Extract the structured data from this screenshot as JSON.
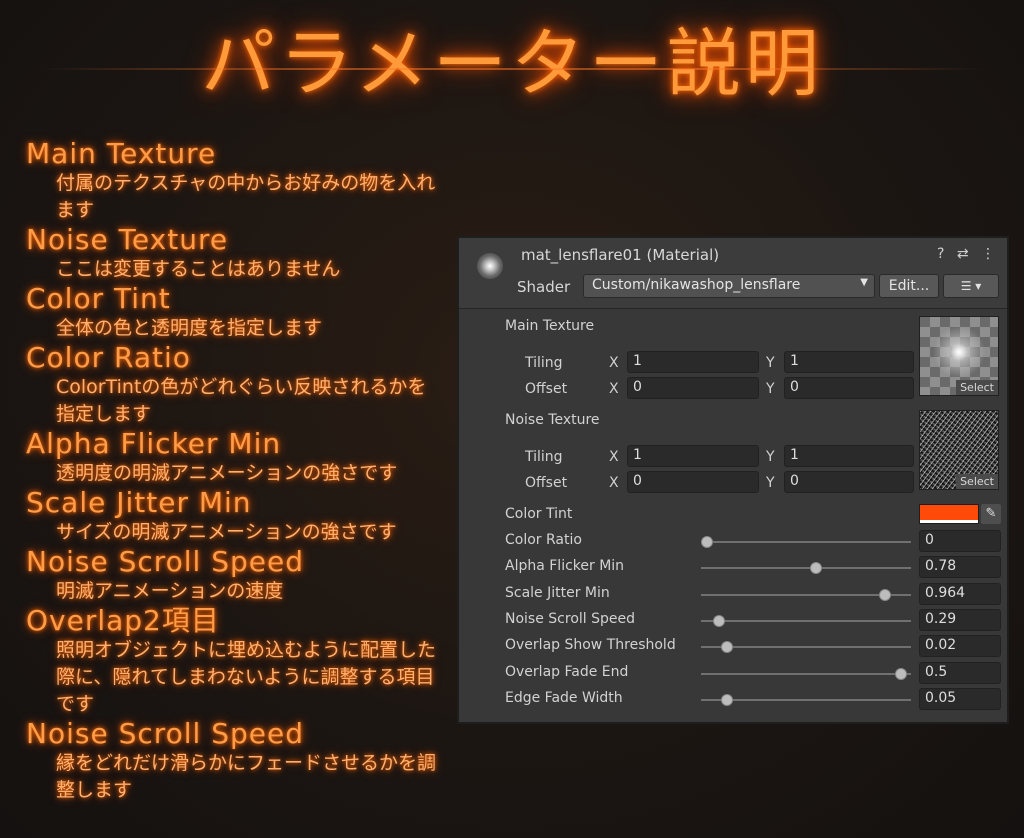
{
  "title": "パラメーター説明",
  "params": [
    {
      "name": "Main Texture",
      "desc": "付属のテクスチャの中からお好みの物を入れます"
    },
    {
      "name": "Noise Texture",
      "desc": "ここは変更することはありません"
    },
    {
      "name": "Color Tint",
      "desc": "全体の色と透明度を指定します"
    },
    {
      "name": "Color Ratio",
      "desc": "ColorTintの色がどれぐらい反映されるかを指定します"
    },
    {
      "name": "Alpha Flicker Min",
      "desc": "透明度の明滅アニメーションの強さです"
    },
    {
      "name": "Scale Jitter Min",
      "desc": "サイズの明滅アニメーションの強さです"
    },
    {
      "name": "Noise Scroll Speed",
      "desc": "明滅アニメーションの速度"
    },
    {
      "name": "Overlap2項目",
      "desc": "照明オブジェクトに埋め込むように配置した際に、隠れてしまわないように調整する項目です"
    },
    {
      "name": "Noise Scroll Speed",
      "desc": "縁をどれだけ滑らかにフェードさせるかを調整します"
    }
  ],
  "inspector": {
    "material_name": "mat_lensflare01 (Material)",
    "header_icons": "? ⇄ ⋮",
    "shader_label": "Shader",
    "shader_value": "Custom/nikawashop_lensflare",
    "edit_label": "Edit...",
    "list_label": "☰ ▾",
    "main_texture": {
      "label": "Main Texture",
      "tiling_label": "Tiling",
      "offset_label": "Offset",
      "x_label": "X",
      "y_label": "Y",
      "tiling_x": "1",
      "tiling_y": "1",
      "offset_x": "0",
      "offset_y": "0",
      "select_label": "Select"
    },
    "noise_texture": {
      "label": "Noise Texture",
      "tiling_label": "Tiling",
      "offset_label": "Offset",
      "x_label": "X",
      "y_label": "Y",
      "tiling_x": "1",
      "tiling_y": "1",
      "offset_x": "0",
      "offset_y": "0",
      "select_label": "Select"
    },
    "color_tint": {
      "label": "Color Tint",
      "color": "#ff4a0a"
    },
    "sliders": [
      {
        "label": "Color Ratio",
        "value": "0",
        "fraction": 0.0
      },
      {
        "label": "Alpha Flicker Min",
        "value": "0.78",
        "fraction": 0.55
      },
      {
        "label": "Scale Jitter Min",
        "value": "0.964",
        "fraction": 0.9
      },
      {
        "label": "Noise Scroll Speed",
        "value": "0.29",
        "fraction": 0.06
      },
      {
        "label": "Overlap Show Threshold",
        "value": "0.02",
        "fraction": 0.1
      },
      {
        "label": "Overlap Fade End",
        "value": "0.5",
        "fraction": 0.98
      },
      {
        "label": "Edge Fade Width",
        "value": "0.05",
        "fraction": 0.1
      }
    ]
  },
  "colors": {
    "glow": "#ff9a3a",
    "panel": "#383838",
    "accent": "#ff4a0a"
  }
}
